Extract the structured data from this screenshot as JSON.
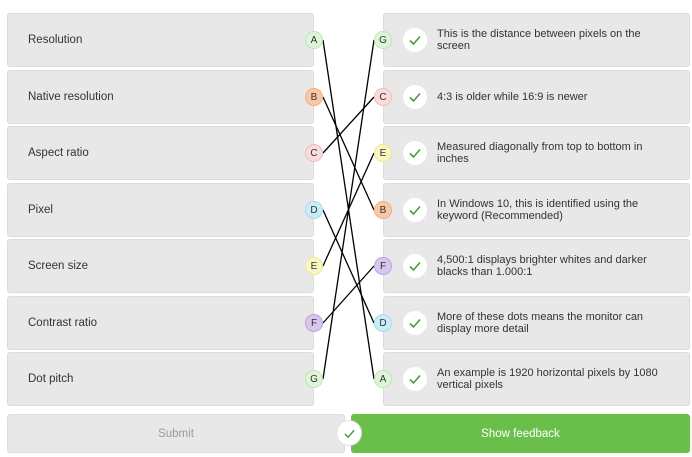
{
  "left_items": [
    {
      "label": "Resolution",
      "letter": "A",
      "color": "#dff5d9",
      "border": "#bfe6b5"
    },
    {
      "label": "Native resolution",
      "letter": "B",
      "color": "#f9c9a7",
      "border": "#f0ae84"
    },
    {
      "label": "Aspect ratio",
      "letter": "C",
      "color": "#fbdcdc",
      "border": "#f0bcbc"
    },
    {
      "label": "Pixel",
      "letter": "D",
      "color": "#c9ecf8",
      "border": "#a6dcef"
    },
    {
      "label": "Screen size",
      "letter": "E",
      "color": "#faf6c2",
      "border": "#ece59a"
    },
    {
      "label": "Contrast ratio",
      "letter": "F",
      "color": "#d7c6ee",
      "border": "#bca3e0"
    },
    {
      "label": "Dot pitch",
      "letter": "G",
      "color": "#dff5d9",
      "border": "#bfe6b5"
    }
  ],
  "right_items": [
    {
      "text": "This is the distance between pixels on the screen",
      "letter": "G",
      "color": "#dff5d9",
      "border": "#bfe6b5"
    },
    {
      "text": "4:3 is older while 16:9 is newer",
      "letter": "C",
      "color": "#fbdcdc",
      "border": "#f0bcbc"
    },
    {
      "text": "Measured diagonally from top to bottom in inches",
      "letter": "E",
      "color": "#faf6c2",
      "border": "#ece59a"
    },
    {
      "text": "In Windows 10, this is identified using the keyword (Recommended)",
      "letter": "B",
      "color": "#f9c9a7",
      "border": "#f0ae84"
    },
    {
      "text": "4,500:1 displays brighter whites and darker blacks than 1.000:1",
      "letter": "F",
      "color": "#d7c6ee",
      "border": "#bca3e0"
    },
    {
      "text": "More of these dots means the monitor can display more detail",
      "letter": "D",
      "color": "#c9ecf8",
      "border": "#a6dcef"
    },
    {
      "text": "An example is 1920 horizontal pixels by 1080 vertical pixels",
      "letter": "A",
      "color": "#dff5d9",
      "border": "#bfe6b5"
    }
  ],
  "buttons": {
    "submit": "Submit",
    "show_feedback": "Show feedback"
  },
  "icons": {
    "check": "check-icon",
    "check_color": "#4a9a3c",
    "line_color": "#000000"
  }
}
